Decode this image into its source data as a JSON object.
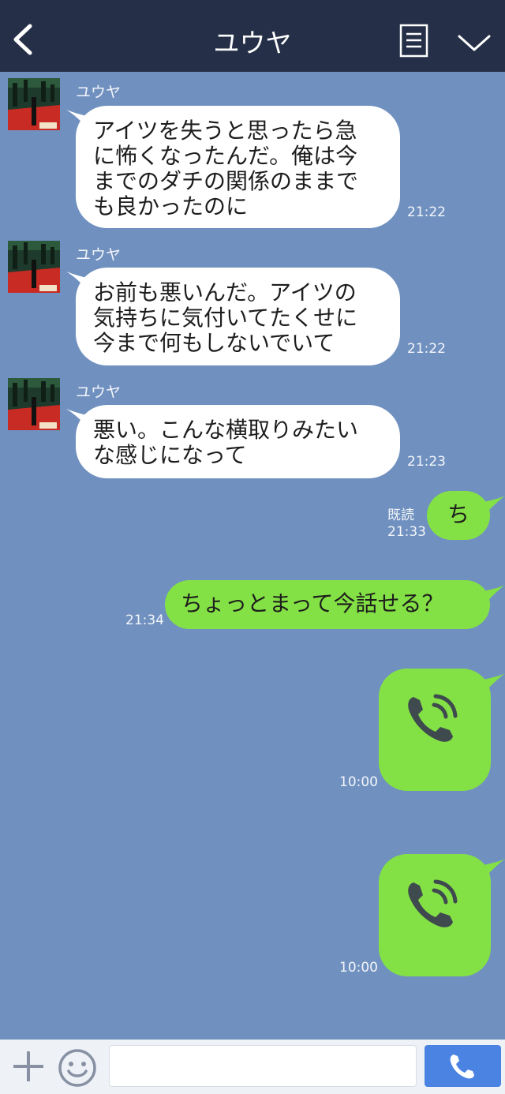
{
  "header": {
    "title": "ユウヤ",
    "back_icon": "chevron-left-icon",
    "menu_icon": "list-icon",
    "down_icon": "chevron-down-icon",
    "background": "#253048"
  },
  "chat": {
    "background": "#7091bf",
    "messages": [
      {
        "direction": "in",
        "sender": "ユウヤ",
        "lines": [
          "アイツを失うと思ったら急",
          "に怖くなったんだ。俺は今",
          "までのダチの関係のままで",
          "も良かったのに"
        ],
        "time": "21:22"
      },
      {
        "direction": "in",
        "sender": "ユウヤ",
        "lines": [
          "お前も悪いんだ。アイツの",
          "気持ちに気付いてたくせに",
          "今まで何もしないでいて"
        ],
        "time": "21:22"
      },
      {
        "direction": "in",
        "sender": "ユウヤ",
        "lines": [
          "悪い。こんな横取りみたい",
          "な感じになって"
        ],
        "time": "21:23"
      },
      {
        "direction": "out",
        "text": "ち",
        "read": "既読",
        "time": "21:33"
      },
      {
        "direction": "out",
        "text": "ちょっとまって今話せる？",
        "time": "21:34"
      },
      {
        "direction": "out",
        "type": "call",
        "icon": "phone-call-icon",
        "time": "10:00"
      },
      {
        "direction": "out",
        "type": "call",
        "icon": "phone-call-icon",
        "time": "10:00"
      }
    ],
    "incoming_bubble_color": "#ffffff",
    "outgoing_bubble_color": "#84e145"
  },
  "bottombar": {
    "plus_icon": "plus-icon",
    "emoji_icon": "smiley-icon",
    "input_value": "",
    "input_placeholder": "",
    "send_icon": "phone-icon",
    "send_color": "#4b83e3"
  }
}
